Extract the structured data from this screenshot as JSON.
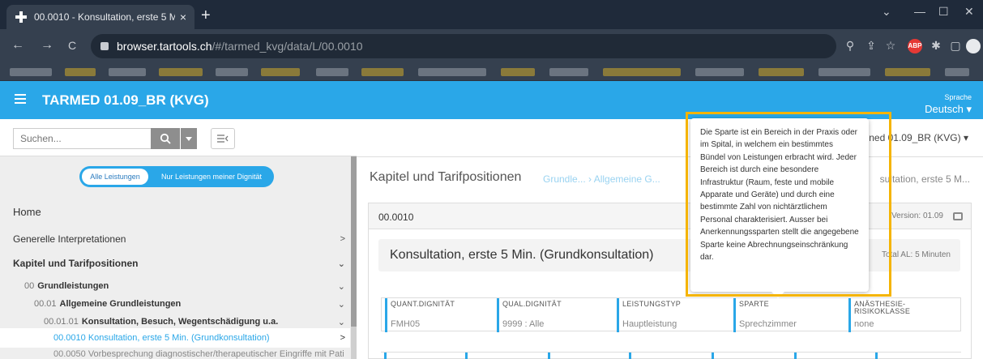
{
  "browser": {
    "tab_title": "00.0010 - Konsultation, erste 5 M",
    "tab_close": "×",
    "new_tab": "+",
    "url_host": "browser.tartools.ch",
    "url_path": "/#/tarmed_kvg/data/L/00.0010",
    "win_minimize": "—",
    "win_maximize": "☐",
    "win_close": "✕",
    "win_collapse": "⌄",
    "back": "←",
    "forward": "→",
    "reload": "C",
    "abp_label": "ABP"
  },
  "app": {
    "title": "TARMED 01.09_BR (KVG)",
    "language_label": "Sprache",
    "language_value": "Deutsch ▾"
  },
  "sidebar": {
    "search_placeholder": "Suchen...",
    "toggle_all": "Alle Leistungen",
    "toggle_mine": "Nur Leistungen meiner Dignität",
    "items": [
      {
        "label": "Home",
        "chevron": ""
      },
      {
        "label": "Generelle Interpretationen",
        "chevron": ">"
      },
      {
        "label": "Kapitel und Tarifpositionen",
        "chevron": "⌄"
      },
      {
        "code": "00",
        "label": "Grundleistungen",
        "chevron": "⌄"
      },
      {
        "code": "00.01",
        "label": "Allgemeine Grundleistungen",
        "chevron": "⌄"
      },
      {
        "code": "00.01.01",
        "label": "Konsultation, Besuch, Wegentschädigung u.a.",
        "chevron": "⌄"
      },
      {
        "label": "00.0010 Konsultation, erste 5 Min. (Grundkonsultation)",
        "chevron": ">"
      },
      {
        "label": "00.0050 Vorbesprechung diagnostischer/therapeutischer Eingriffe mit Pati",
        "chevron": ""
      }
    ]
  },
  "main": {
    "version_select": "ned 01.09_BR (KVG) ▾",
    "heading": "Kapitel und Tarifpositionen",
    "breadcrumb": "Grundle... › Allgemeine G...",
    "breadcrumb_end": "sultation, erste 5 M...",
    "code": "00.0010",
    "version": "Version: 01.09",
    "title": "Konsultation, erste 5 Min. (Grundkonsultation)",
    "total_al": "Total AL: 5 Minuten",
    "attributes": [
      {
        "label": "QUANT.DIGNITÄT",
        "value": "FMH05"
      },
      {
        "label": "QUAL.DIGNITÄT",
        "value": "9999 : Alle"
      },
      {
        "label": "LEISTUNGSTYP",
        "value": "Hauptleistung"
      },
      {
        "label": "SPARTE",
        "value": "Sprechzimmer"
      },
      {
        "label": "ANÄSTHESIE-RISIKOKLASSE",
        "value": "none"
      }
    ]
  },
  "tooltip": {
    "text": "Die Sparte ist ein Bereich in der Praxis oder im Spital, in welchem ein bestimmtes Bündel von Leistungen erbracht wird. Jeder Bereich ist durch eine besondere Infrastruktur (Raum, feste und mobile Apparate und Geräte) und durch eine bestimmte Zahl von nichtärztlichem Personal charakterisiert. Ausser bei Anerkennungssparten stellt die angegebene Sparte keine Abrechnungseinschränkung dar."
  },
  "colors": {
    "accent": "#2aa7e8",
    "highlight": "#f5b400"
  }
}
